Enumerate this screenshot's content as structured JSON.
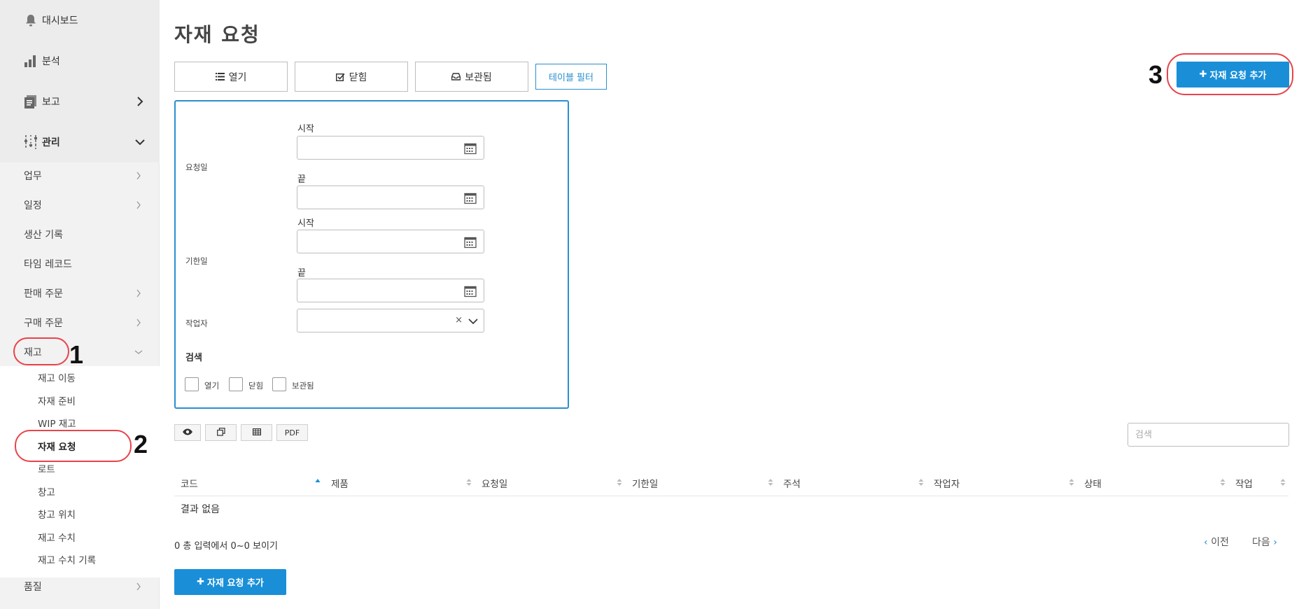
{
  "sidebar": {
    "main": [
      {
        "label": "대시보드",
        "icon": "bell-icon"
      },
      {
        "label": "분석",
        "icon": "bar-chart-icon"
      },
      {
        "label": "보고",
        "icon": "report-icon"
      },
      {
        "label": "관리",
        "icon": "sliders-icon"
      }
    ],
    "items": [
      {
        "label": "업무",
        "has_children": true
      },
      {
        "label": "일정",
        "has_children": true
      },
      {
        "label": "생산 기록",
        "has_children": false
      },
      {
        "label": "타임 레코드",
        "has_children": false
      },
      {
        "label": "판매 주문",
        "has_children": true
      },
      {
        "label": "구매 주문",
        "has_children": true
      },
      {
        "label": "재고",
        "has_children": true,
        "expanded": true
      }
    ],
    "subitems": [
      {
        "label": "재고 이동"
      },
      {
        "label": "자재 준비"
      },
      {
        "label": "WIP 재고"
      },
      {
        "label": "자재 요청",
        "active": true
      },
      {
        "label": "로트"
      },
      {
        "label": "창고"
      },
      {
        "label": "창고 위치"
      },
      {
        "label": "재고 수치"
      },
      {
        "label": "재고 수치 기록"
      }
    ],
    "bottom_item": {
      "label": "품질"
    }
  },
  "annotations": [
    "1",
    "2",
    "3"
  ],
  "page": {
    "title": "자재 요청",
    "tabs": [
      {
        "label": "열기",
        "icon": "list-icon"
      },
      {
        "label": "닫힘",
        "icon": "check-square-icon"
      },
      {
        "label": "보관됨",
        "icon": "inbox-icon"
      }
    ],
    "filter_button": "테이블 필터",
    "add_button": "자재 요청 추가"
  },
  "filter": {
    "request_date_label": "요청일",
    "due_date_label": "기한일",
    "start_label": "시작",
    "end_label": "끝",
    "worker_label": "작업자",
    "search_heading": "검색",
    "status_checks": [
      "열기",
      "닫힘",
      "보관됨"
    ]
  },
  "toolbar": {
    "pdf_label": "PDF",
    "search_placeholder": "검색"
  },
  "table": {
    "columns": [
      "코드",
      "제품",
      "요청일",
      "기한일",
      "주석",
      "작업자",
      "상태",
      "작업"
    ],
    "empty_text": "결과 없음",
    "info_text": "0 총 입력에서 0~0 보이기",
    "prev_label": "이전",
    "next_label": "다음"
  },
  "colors": {
    "primary": "#1a8fd8",
    "annotation": "#e8434b",
    "sidebar_bg": "#f2f2f2"
  }
}
